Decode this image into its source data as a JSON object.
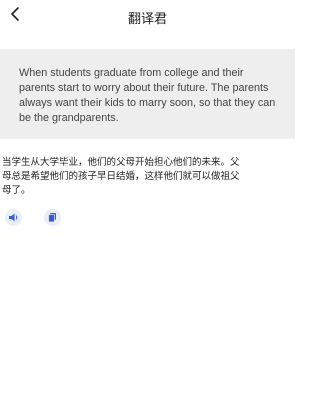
{
  "header": {
    "title": "翻译君",
    "back_icon": "chevron-left-icon"
  },
  "source": {
    "text": "When students graduate from college and their parents start to worry about their future. The parents always want their kids to marry soon, so that they can be the grandparents."
  },
  "translation": {
    "text": "当学生从大学毕业，他们的父母开始担心他们的未来。父母总是希望他们的孩子早日结婚，这样他们就可以做祖父母了。"
  },
  "actions": {
    "speak_icon": "speaker-icon",
    "copy_icon": "copy-icon"
  },
  "colors": {
    "accent": "#3a5bd9",
    "card_bg": "#eeeeee",
    "icon_bg": "#e9eefb"
  }
}
